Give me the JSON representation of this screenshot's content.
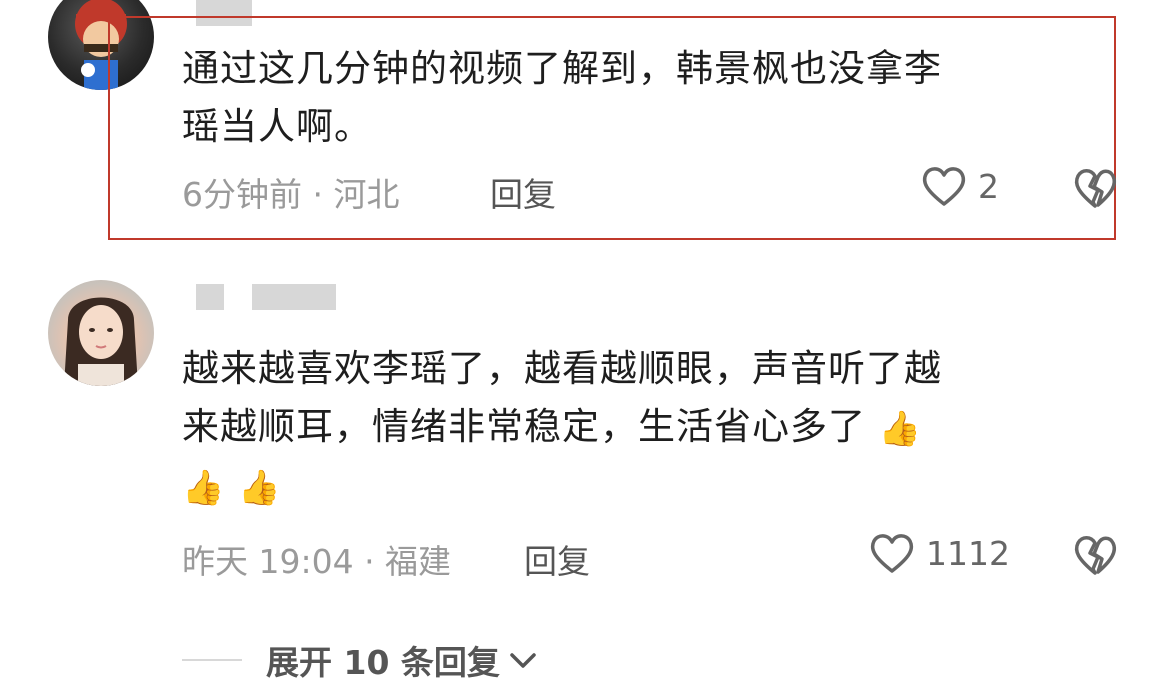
{
  "comments": [
    {
      "text_line1": "通过这几分钟的视频了解到，韩景枫也没拿李",
      "text_line2": "瑶当人啊。",
      "meta": "6分钟前 · 河北",
      "reply_label": "回复",
      "like_count": "2"
    },
    {
      "text_line1": "越来越喜欢李瑶了，越看越顺眼，声音听了越",
      "text_line2": "来越顺耳，情绪非常稳定，生活省心多了",
      "emoji": "👍",
      "meta": "昨天 19:04 · 福建",
      "reply_label": "回复",
      "like_count": "1112"
    }
  ],
  "expand_replies_label": "展开 10 条回复",
  "icons": {
    "like": "heart-outline-icon",
    "dislike": "broken-heart-icon",
    "chevron": "chevron-down-icon"
  },
  "colors": {
    "highlight_border": "#c0392b",
    "meta_text": "#9a9a9a",
    "thumb_yellow": "#f7c23a",
    "thumb_red": "#e85a5a"
  }
}
